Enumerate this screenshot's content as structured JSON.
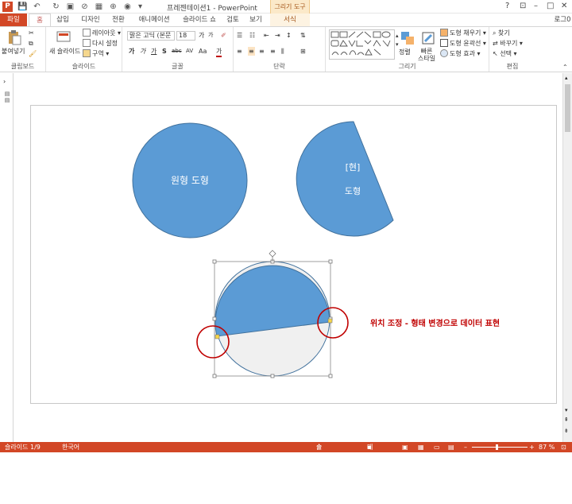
{
  "window": {
    "title": "프레젠테이션1 - PowerPoint",
    "context_tab_header": "그리기 도구",
    "login": "로그0",
    "controls": [
      "?",
      "⊡",
      "–",
      "□",
      "✕"
    ]
  },
  "tabs": [
    {
      "label": "파일"
    },
    {
      "label": "홈"
    },
    {
      "label": "삽입"
    },
    {
      "label": "디자인"
    },
    {
      "label": "전환"
    },
    {
      "label": "애니메이션"
    },
    {
      "label": "슬라이드 쇼"
    },
    {
      "label": "검토"
    },
    {
      "label": "보기"
    },
    {
      "label": "서식"
    }
  ],
  "ribbon": {
    "clipboard": {
      "label": "클립보드",
      "paste": "붙여넣기"
    },
    "slides": {
      "label": "슬라이드",
      "new_slide": "새 슬라이드",
      "layout": "레이아웃 ▾",
      "reset": "다시 설정",
      "section": "구역 ▾"
    },
    "font": {
      "label": "글꼴",
      "font_name": "맑은 고딕 (본문",
      "font_size": "18",
      "b": "가",
      "i": "가",
      "u": "가",
      "s": "S",
      "abc": "abc",
      "av": "AV",
      "aa": "Aa",
      "grow": "가",
      "shrink": "가",
      "color": "가"
    },
    "paragraph": {
      "label": "단락"
    },
    "drawing": {
      "label": "그리기",
      "arrange": "정렬",
      "quick_styles": "빠른\n스타일",
      "fill": "도형 채우기 ▾",
      "outline": "도형 윤곽선 ▾",
      "effects": "도형 효과 ▾"
    },
    "editing": {
      "label": "편집",
      "find": "찾기",
      "replace": "바꾸기 ▾",
      "select": "선택 ▾"
    }
  },
  "slide": {
    "circle_label": "원형 도형",
    "chord_label_line1": "[현]",
    "chord_label_line2": "도형",
    "annotation": "위치 조정 - 형태 변경으로 데이터 표현"
  },
  "status": {
    "slide_info": "슬라이드 1/9",
    "language": "한국어",
    "notes": "슬라이드 노트",
    "comments": "메모",
    "zoom": "87 %"
  },
  "colors": {
    "accent": "#d24726",
    "shape_fill": "#5b9bd5",
    "shape_outline": "#41719c",
    "light_fill": "#f0f0f0",
    "highlight_circle": "#c00000",
    "annotation_text": "#c00000"
  }
}
